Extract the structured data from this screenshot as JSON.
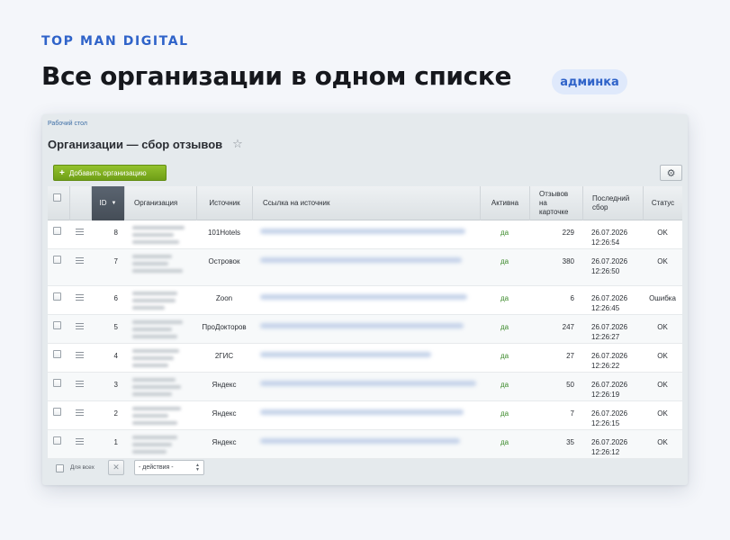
{
  "brand": "TOP MAN DIGITAL",
  "headline": "Все организации в одном списке",
  "badge": "админка",
  "window": {
    "breadcrumb": "Рабочий стол",
    "title": "Организации — сбор отзывов",
    "add_button": "Добавить организацию",
    "columns": {
      "id": "ID",
      "org": "Организация",
      "source": "Источник",
      "link": "Ссылка на источник",
      "active": "Активна",
      "reviews": [
        "Отзывов",
        "на",
        "карточке"
      ],
      "last": [
        "Последний",
        "сбор"
      ],
      "status": "Статус"
    },
    "rows": [
      {
        "id": "8",
        "source": "101Hotels",
        "active": "да",
        "reviews": "229",
        "date": "26.07.2026",
        "time": "12:26:54",
        "status": "OK"
      },
      {
        "id": "7",
        "source": "Островок",
        "active": "да",
        "reviews": "380",
        "date": "26.07.2026",
        "time": "12:26:50",
        "status": "OK"
      },
      {
        "id": "6",
        "source": "Zoon",
        "active": "да",
        "reviews": "6",
        "date": "26.07.2026",
        "time": "12:26:45",
        "status": "Ошибка"
      },
      {
        "id": "5",
        "source": "ПроДокторов",
        "active": "да",
        "reviews": "247",
        "date": "26.07.2026",
        "time": "12:26:27",
        "status": "OK"
      },
      {
        "id": "4",
        "source": "2ГИС",
        "active": "да",
        "reviews": "27",
        "date": "26.07.2026",
        "time": "12:26:22",
        "status": "OK"
      },
      {
        "id": "3",
        "source": "Яндекс",
        "active": "да",
        "reviews": "50",
        "date": "26.07.2026",
        "time": "12:26:19",
        "status": "OK"
      },
      {
        "id": "2",
        "source": "Яндекс",
        "active": "да",
        "reviews": "7",
        "date": "26.07.2026",
        "time": "12:26:15",
        "status": "OK"
      },
      {
        "id": "1",
        "source": "Яндекс",
        "active": "да",
        "reviews": "35",
        "date": "26.07.2026",
        "time": "12:26:12",
        "status": "OK"
      }
    ],
    "footer": {
      "for_all": "Для всех",
      "x_glyph": "✕",
      "actions": "- действия -"
    }
  },
  "colors": {
    "brand_blue": "#2f63c9",
    "badge_bg": "#dfe9fb",
    "add_green": "#7fae1e",
    "active_green": "#3d8b2c"
  },
  "icons": [
    "star-icon",
    "gear-icon",
    "plus-icon",
    "row-menu-icon",
    "sort-caret-icon",
    "close-icon",
    "select-arrow-icon"
  ]
}
